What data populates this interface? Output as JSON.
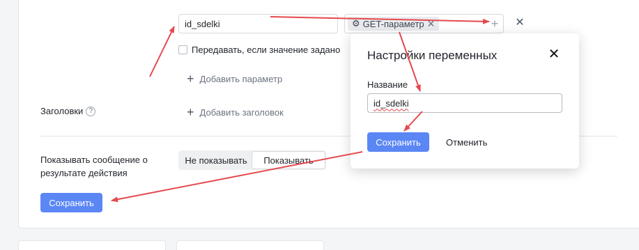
{
  "params": {
    "name_value": "id_sdelki",
    "token_label": "GET-параметр",
    "token_remove_glyph": "✕",
    "add_token_glyph": "+",
    "remove_row_glyph": "✕",
    "checkbox_label": "Передавать, если значение задано",
    "add_param_label": "Добавить параметр"
  },
  "headers": {
    "label": "Заголовки",
    "help_glyph": "?",
    "add_header_label": "Добавить заголовок"
  },
  "show_message": {
    "label": "Показывать сообщение о результате действия",
    "options": [
      "Не показывать",
      "Показывать"
    ],
    "selected": "Показывать"
  },
  "save_label": "Сохранить",
  "modal": {
    "title": "Настройки переменных",
    "close_glyph": "✕",
    "field_label": "Название",
    "field_value": "id_sdelki",
    "save_label": "Сохранить",
    "cancel_label": "Отменить"
  },
  "colors": {
    "primary": "#5b87f5",
    "annotation_arrow": "#e5484d"
  },
  "icons": {
    "token_icon": "gear-icon",
    "add_icon": "plus-icon",
    "close_icon": "close-icon",
    "help_icon": "question-icon"
  }
}
